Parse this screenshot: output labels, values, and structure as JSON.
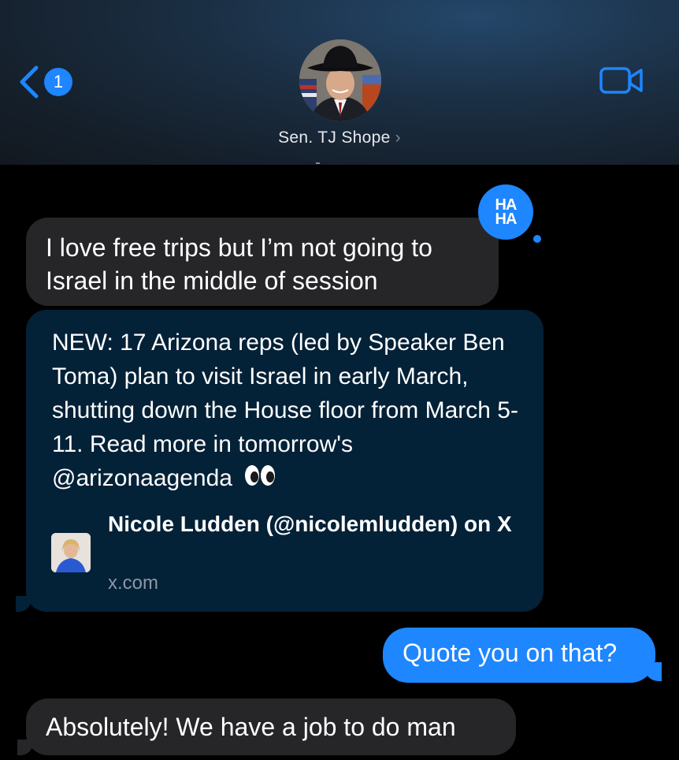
{
  "header": {
    "back_badge": "1",
    "contact_name": "Sen. TJ Shope",
    "contact_chevron": "›",
    "video_icon": "video-camera-icon",
    "back_icon": "chevron-left-icon"
  },
  "messages": {
    "incoming_1": "I love free trips but I’m not going to Israel in the middle of session",
    "reaction": {
      "top": "HA",
      "bottom": "HA",
      "type": "haha"
    },
    "link_preview": {
      "text": "NEW: 17 Arizona reps (led by Speaker Ben Toma) plan to visit Israel in early March, shutting down the House floor from March 5-11. Read more in tomorrow's @arizonaagenda",
      "title": "Nicole Ludden (@nicolemludden) on X",
      "domain": "x.com"
    },
    "outgoing_1": "Quote you on that?",
    "incoming_2": "Absolutely! We have a job to do man"
  },
  "colors": {
    "accent": "#1e86ff",
    "incoming_bubble": "#262629",
    "link_bubble": "#032137"
  }
}
